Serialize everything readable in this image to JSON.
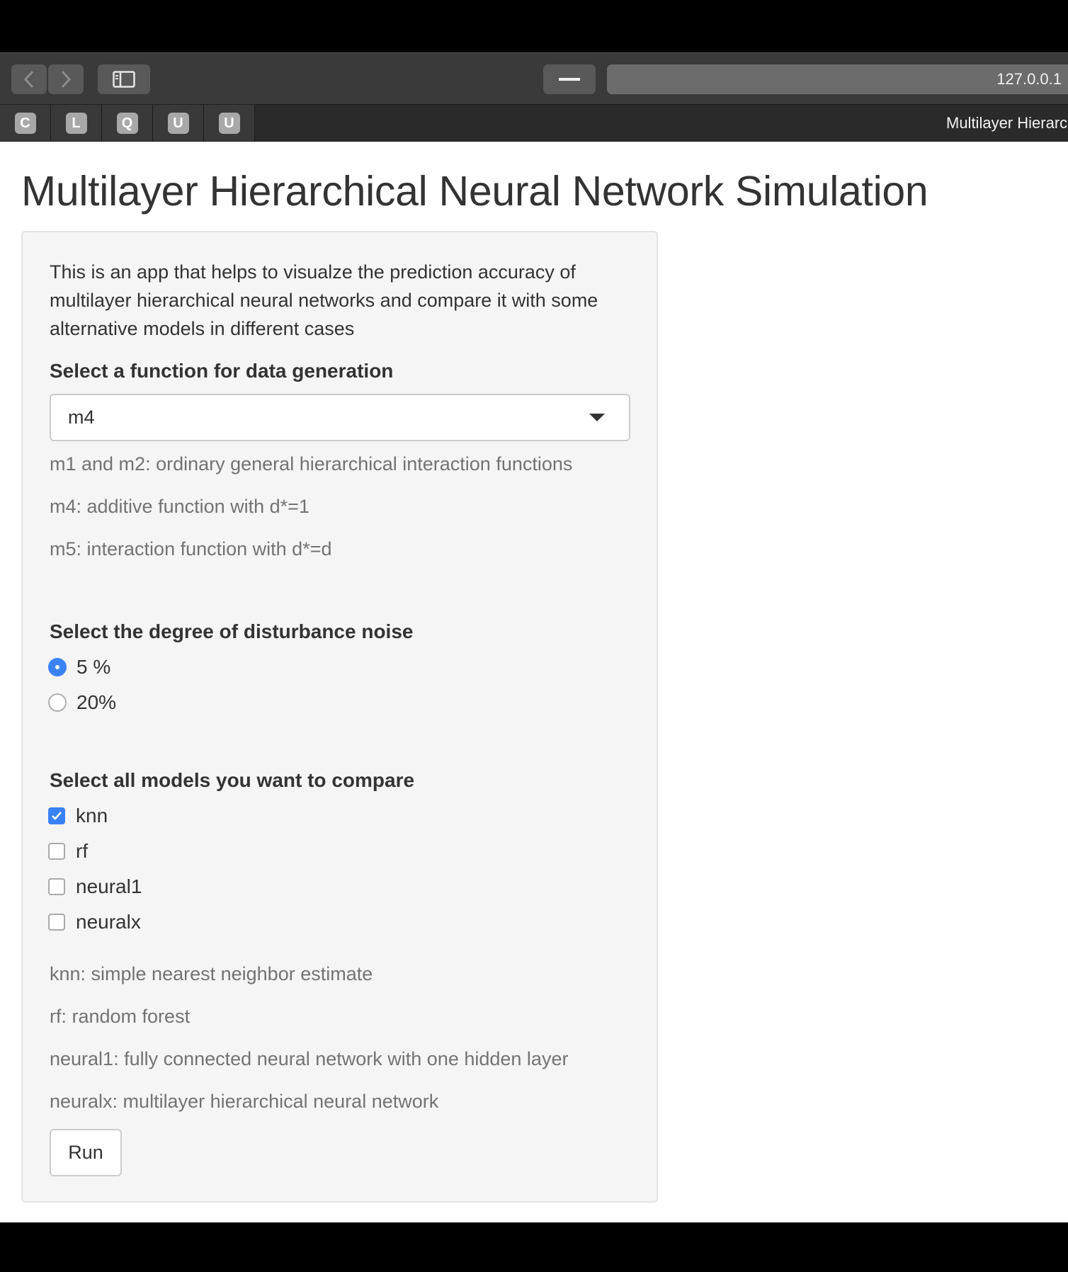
{
  "browser": {
    "url": "127.0.0.1",
    "tab_title": "Multilayer Hierarchical Neural Network Simulation",
    "pinned_tabs": [
      "C",
      "L",
      "Q",
      "U",
      "U"
    ]
  },
  "page": {
    "title": "Multilayer Hierarchical Neural Network Simulation",
    "intro": "This is an app that helps to visualze the prediction accuracy of multilayer hierarchical neural networks and compare it with some alternative models in different cases",
    "function_select": {
      "label": "Select a function for data generation",
      "value": "m4",
      "help": [
        "m1 and m2: ordinary general hierarchical interaction functions",
        "m4: additive function with d*=1",
        "m5: interaction function with d*=d"
      ]
    },
    "noise": {
      "label": "Select the degree of disturbance noise",
      "options": [
        {
          "label": "5 %",
          "selected": true
        },
        {
          "label": "20%",
          "selected": false
        }
      ]
    },
    "models": {
      "label": "Select all models you want to compare",
      "options": [
        {
          "label": "knn",
          "checked": true
        },
        {
          "label": "rf",
          "checked": false
        },
        {
          "label": "neural1",
          "checked": false
        },
        {
          "label": "neuralx",
          "checked": false
        }
      ],
      "help": [
        "knn: simple nearest neighbor estimate",
        "rf: random forest",
        "neural1: fully connected neural network with one hidden layer",
        "neuralx: multilayer hierarchical neural network"
      ]
    },
    "run_label": "Run"
  },
  "colors": {
    "accent": "#3b82f6",
    "well_bg": "#f5f5f5",
    "help_text": "#737373"
  }
}
